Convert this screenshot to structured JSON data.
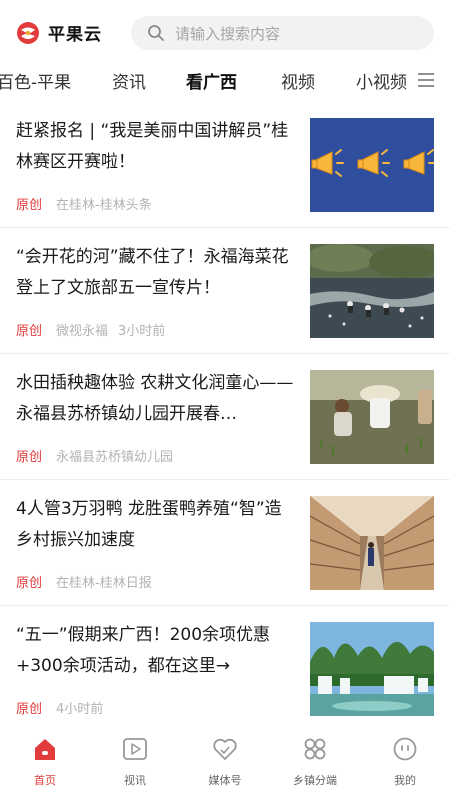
{
  "header": {
    "app_name": "平果云",
    "logo_icon": "app-logo",
    "search_placeholder": "请输入搜索内容",
    "brand_color": "#e23b3b"
  },
  "tabs": [
    {
      "label": "百色-平果",
      "active": false
    },
    {
      "label": "资讯",
      "active": false
    },
    {
      "label": "看广西",
      "active": true
    },
    {
      "label": "视频",
      "active": false
    },
    {
      "label": "小视频",
      "active": false
    }
  ],
  "feed": [
    {
      "title": "赶紧报名 | “我是美丽中国讲解员”桂林赛区开赛啦！",
      "badge": "原创",
      "source": "在桂林-桂林头条",
      "time": "",
      "image": "megaphones-on-blue"
    },
    {
      "title": "“会开花的河”藏不住了！永福海菜花登上了文旅部五一宣传片！",
      "badge": "原创",
      "source": "微视永福",
      "time": "3小时前",
      "image": "people-in-river"
    },
    {
      "title": "水田插秧趣体验 农耕文化润童心——永福县苏桥镇幼儿园开展春…",
      "badge": "原创",
      "source": "永福县苏桥镇幼儿园",
      "time": "",
      "image": "children-planting-rice"
    },
    {
      "title": "4人管3万羽鸭 龙胜蛋鸭养殖“智”造乡村振兴加速度",
      "badge": "原创",
      "source": "在桂林-桂林日报",
      "time": "",
      "image": "duck-farm-cages"
    },
    {
      "title": "“五一”假期来广西！200余项优惠+300余项活动，都在这里→",
      "badge": "原创",
      "source": "",
      "time": "4小时前",
      "image": "karst-waterfall"
    }
  ],
  "bottom_nav": [
    {
      "label": "首页",
      "icon": "home-icon",
      "active": true
    },
    {
      "label": "视讯",
      "icon": "video-play-icon",
      "active": false
    },
    {
      "label": "媒体号",
      "icon": "media-heart-icon",
      "active": false
    },
    {
      "label": "乡镇分端",
      "icon": "grid-icon",
      "active": false
    },
    {
      "label": "我的",
      "icon": "profile-face-icon",
      "active": false
    }
  ]
}
